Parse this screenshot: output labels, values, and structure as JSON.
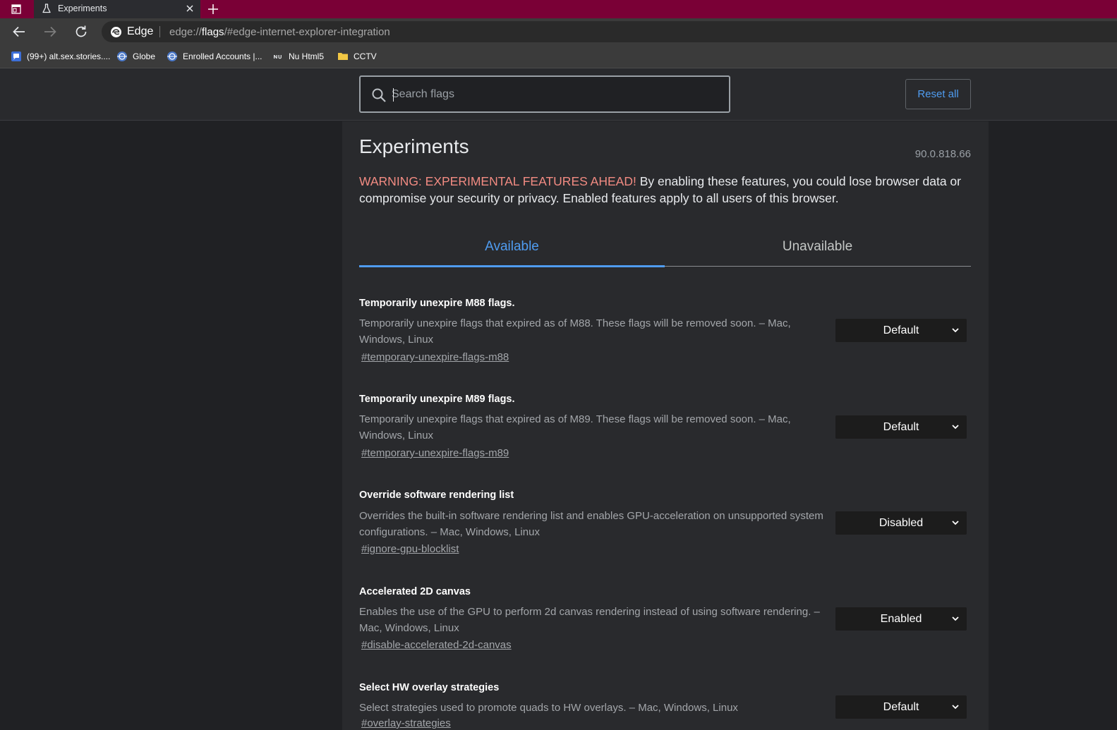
{
  "tab": {
    "title": "Experiments"
  },
  "omnibox": {
    "brand": "Edge",
    "url_prefix": "edge://",
    "url_host": "flags",
    "url_rest": "/#edge-internet-explorer-integration"
  },
  "bookmarks": [
    {
      "label": "(99+) alt.sex.stories...."
    },
    {
      "label": "Globe"
    },
    {
      "label": "Enrolled Accounts |..."
    },
    {
      "label": "Nu Html5"
    },
    {
      "label": "CCTV"
    }
  ],
  "header": {
    "search_placeholder": "Search flags",
    "reset_label": "Reset all"
  },
  "main": {
    "title": "Experiments",
    "version": "90.0.818.66",
    "warning_red": "WARNING: EXPERIMENTAL FEATURES AHEAD!",
    "warning_text": " By enabling these features, you could lose browser data or compromise your security or privacy. Enabled features apply to all users of this browser.",
    "tabs": [
      {
        "label": "Available"
      },
      {
        "label": "Unavailable"
      }
    ]
  },
  "flags": [
    {
      "name": "Temporarily unexpire M88 flags.",
      "description": "Temporarily unexpire flags that expired as of M88. These flags will be removed soon. – Mac, Windows, Linux",
      "link": "#temporary-unexpire-flags-m88",
      "value": "Default"
    },
    {
      "name": "Temporarily unexpire M89 flags.",
      "description": "Temporarily unexpire flags that expired as of M89. These flags will be removed soon. – Mac, Windows, Linux",
      "link": "#temporary-unexpire-flags-m89",
      "value": "Default"
    },
    {
      "name": "Override software rendering list",
      "description": "Overrides the built-in software rendering list and enables GPU-acceleration on unsupported system configurations. – Mac, Windows, Linux",
      "link": "#ignore-gpu-blocklist",
      "value": "Disabled"
    },
    {
      "name": "Accelerated 2D canvas",
      "description": "Enables the use of the GPU to perform 2d canvas rendering instead of using software rendering. – Mac, Windows, Linux",
      "link": "#disable-accelerated-2d-canvas",
      "value": "Enabled"
    },
    {
      "name": "Select HW overlay strategies",
      "description": "Select strategies used to promote quads to HW overlays. – Mac, Windows, Linux",
      "link": "#overlay-strategies",
      "value": "Default"
    }
  ],
  "colors": {
    "tabstrip": "#7a0036",
    "accent": "#4f9cf0",
    "warning": "#f28b82"
  }
}
